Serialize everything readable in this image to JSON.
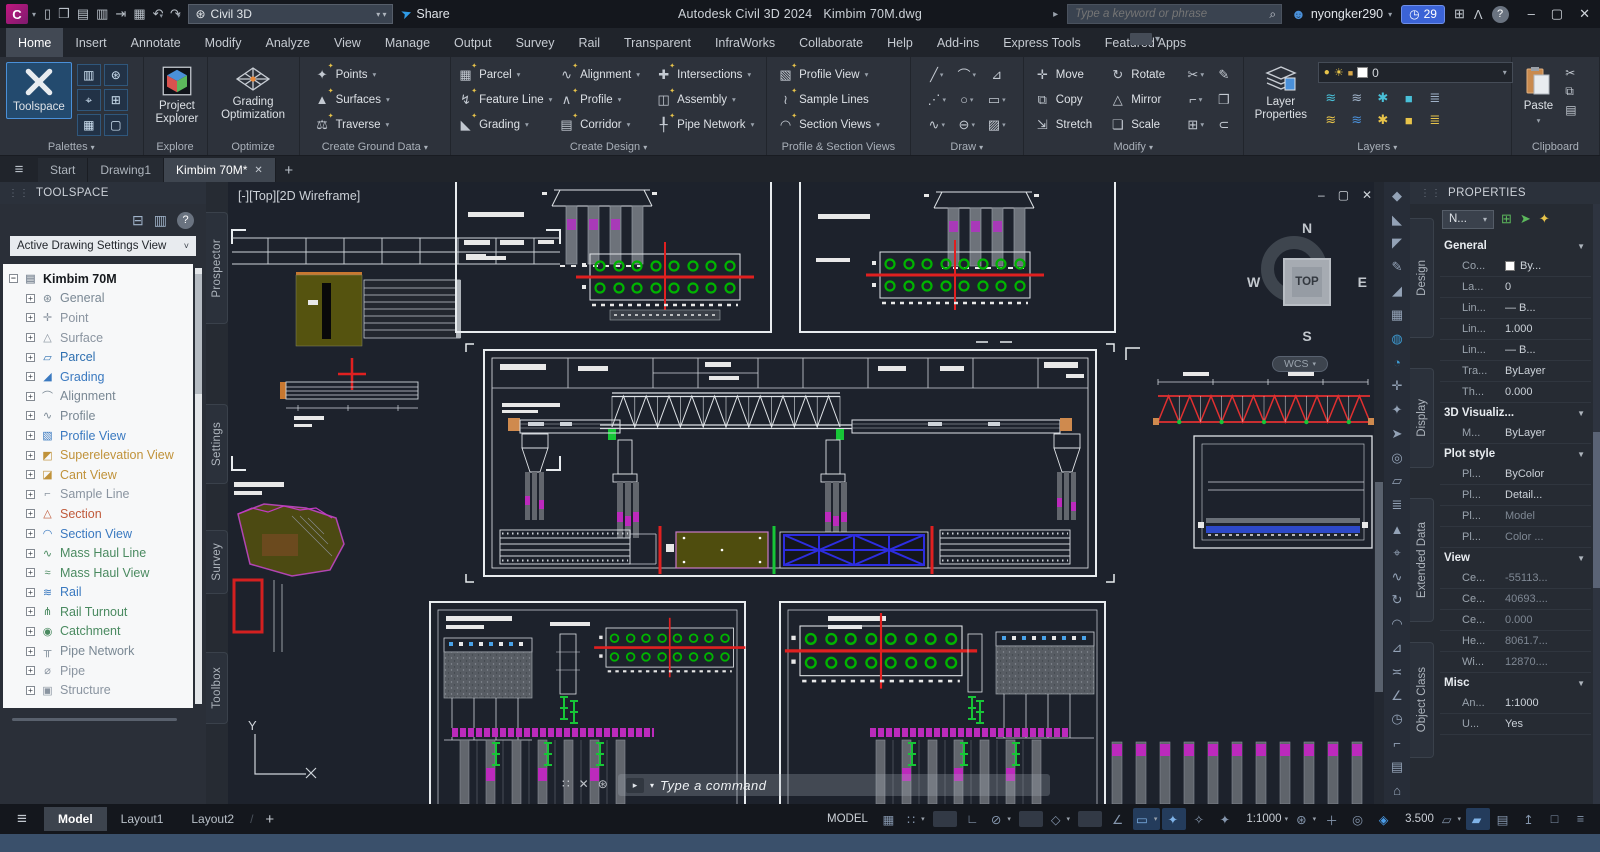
{
  "colors": {
    "canvas_bg": "#1d222c",
    "sheet_line": "#e8ecef",
    "pile_green": "#00b400",
    "magenta": "#bc2abc",
    "red": "#e02020",
    "olive": "#55530f",
    "brace_blue": "#2d2de0",
    "orange": "#c87830",
    "accent_blue": "#4a90d9",
    "trial_badge": "#3b63d6"
  },
  "titlebar": {
    "logo_letter": "C",
    "qat": [
      {
        "id": "new",
        "glyph": "▯"
      },
      {
        "id": "open",
        "glyph": "❒"
      },
      {
        "id": "save",
        "glyph": "▤"
      },
      {
        "id": "save-as",
        "glyph": "▥"
      },
      {
        "id": "export",
        "glyph": "⇥"
      },
      {
        "id": "plot",
        "glyph": "▦"
      },
      {
        "id": "undo",
        "glyph": "↶",
        "dd": true
      },
      {
        "id": "redo",
        "glyph": "↷",
        "dd": true
      }
    ],
    "workspace": {
      "label": "Civil 3D",
      "icon": "⊛"
    },
    "share": "Share",
    "app_title": "Autodesk Civil 3D 2024",
    "doc_title": "Kimbim 70M.dwg",
    "expand_arrow": "▸",
    "search_placeholder": "Type a keyword or phrase",
    "search_icon": "⌕",
    "user": "nyongker290",
    "trial": {
      "icon": "◷",
      "days": "29"
    },
    "cart_icon": "⊞",
    "autodesk_icon": "Λ",
    "help_icon": "?",
    "win": {
      "min": "–",
      "restore": "▢",
      "close": "✕"
    }
  },
  "ribbon": {
    "tabs": [
      {
        "label": "Home",
        "active": true
      },
      {
        "label": "Insert"
      },
      {
        "label": "Annotate"
      },
      {
        "label": "Modify"
      },
      {
        "label": "Analyze"
      },
      {
        "label": "View"
      },
      {
        "label": "Manage"
      },
      {
        "label": "Output"
      },
      {
        "label": "Survey"
      },
      {
        "label": "Rail"
      },
      {
        "label": "Transparent"
      },
      {
        "label": "InfraWorks"
      },
      {
        "label": "Collaborate"
      },
      {
        "label": "Help"
      },
      {
        "label": "Add-ins"
      },
      {
        "label": "Express Tools"
      },
      {
        "label": "Featured Apps"
      }
    ],
    "palettes": {
      "button": "Toolspace",
      "title": "Palettes",
      "caret": "▾",
      "small_icons": [
        {
          "id": "properties-palette",
          "glyph": "▥"
        },
        {
          "id": "settings-palette",
          "glyph": "⊛"
        },
        {
          "id": "survey-palette",
          "glyph": "⌖"
        },
        {
          "id": "toolbox-palette",
          "glyph": "⊞"
        },
        {
          "id": "sheet-set-manager",
          "glyph": "▦"
        },
        {
          "id": "command-line-palette",
          "glyph": "▢"
        }
      ]
    },
    "explore": {
      "button": "Project Explorer",
      "title": "Explore"
    },
    "optimize": {
      "button": "Grading Optimization",
      "title": "Optimize"
    },
    "ground": {
      "title": "Create Ground Data",
      "caret": "▾",
      "items": [
        {
          "id": "points",
          "label": "Points",
          "glyph": "✦",
          "dd": true
        },
        {
          "id": "surfaces",
          "label": "Surfaces",
          "glyph": "▲",
          "dd": true
        },
        {
          "id": "traverse",
          "label": "Traverse",
          "glyph": "⚖",
          "dd": true
        }
      ]
    },
    "design": {
      "title": "Create Design",
      "caret": "▾",
      "col1": [
        {
          "id": "parcel",
          "label": "Parcel",
          "glyph": "▦",
          "dd": true
        },
        {
          "id": "feature-line",
          "label": "Feature Line",
          "glyph": "↯",
          "dd": true
        },
        {
          "id": "grading",
          "label": "Grading",
          "glyph": "◣",
          "dd": true
        }
      ],
      "col2": [
        {
          "id": "alignment",
          "label": "Alignment",
          "glyph": "∿",
          "dd": true
        },
        {
          "id": "profile",
          "label": "Profile",
          "glyph": "∧",
          "dd": true
        },
        {
          "id": "corridor",
          "label": "Corridor",
          "glyph": "▤",
          "dd": true
        }
      ],
      "col3": [
        {
          "id": "intersections",
          "label": "Intersections",
          "glyph": "✚",
          "dd": true
        },
        {
          "id": "assembly",
          "label": "Assembly",
          "glyph": "◫",
          "dd": true
        },
        {
          "id": "pipe-network",
          "label": "Pipe Network",
          "glyph": "╀",
          "dd": true
        }
      ]
    },
    "psv": {
      "title": "Profile & Section Views",
      "items": [
        {
          "id": "profile-view",
          "label": "Profile View",
          "glyph": "▧",
          "dd": true
        },
        {
          "id": "sample-lines",
          "label": "Sample Lines",
          "glyph": "≀"
        },
        {
          "id": "section-views",
          "label": "Section Views",
          "glyph": "◠",
          "dd": true
        }
      ]
    },
    "draw": {
      "title": "Draw",
      "caret": "▾",
      "grid": [
        {
          "id": "line",
          "glyph": "╱",
          "dd": true
        },
        {
          "id": "arc",
          "glyph": "⌒",
          "dd": true
        },
        {
          "id": "polyline",
          "glyph": "⊿"
        },
        {
          "id": "construction-line",
          "glyph": "⋰",
          "dd": true
        },
        {
          "id": "circle",
          "glyph": "○",
          "dd": true
        },
        {
          "id": "rectangle",
          "glyph": "▭",
          "dd": true
        },
        {
          "id": "spline",
          "glyph": "∿",
          "dd": true
        },
        {
          "id": "ellipse",
          "glyph": "⊖",
          "dd": true
        },
        {
          "id": "hatch",
          "glyph": "▨",
          "dd": true
        }
      ]
    },
    "modify": {
      "title": "Modify",
      "caret": "▾",
      "col1": [
        {
          "id": "move",
          "label": "Move",
          "glyph": "✛"
        },
        {
          "id": "copy",
          "label": "Copy",
          "glyph": "⧉"
        },
        {
          "id": "stretch",
          "label": "Stretch",
          "glyph": "⇲"
        }
      ],
      "col2": [
        {
          "id": "rotate",
          "label": "Rotate",
          "glyph": "↻"
        },
        {
          "id": "mirror",
          "label": "Mirror",
          "glyph": "△"
        },
        {
          "id": "scale",
          "label": "Scale",
          "glyph": "❏"
        }
      ],
      "icons1": [
        {
          "id": "trim",
          "glyph": "✂",
          "dd": true
        },
        {
          "id": "fillet",
          "glyph": "⌐",
          "dd": true
        },
        {
          "id": "array",
          "glyph": "⊞",
          "dd": true
        }
      ],
      "icons2": [
        {
          "id": "erase",
          "glyph": "✎"
        },
        {
          "id": "explode",
          "glyph": "❐"
        },
        {
          "id": "overkill",
          "glyph": "⊂"
        }
      ]
    },
    "layers": {
      "button": "Layer Properties",
      "title": "Layers",
      "caret": "▾",
      "current_layer": "0",
      "combo_icons": [
        {
          "id": "layer-on",
          "glyph": "●",
          "color": "#e8c44a"
        },
        {
          "id": "layer-sun",
          "glyph": "☀",
          "color": "#e8c44a"
        },
        {
          "id": "layer-lock",
          "glyph": "■",
          "color": "#d9a84a"
        }
      ],
      "tools": [
        {
          "id": "layer-isolate",
          "glyph": "≋",
          "color": "#49c0d8"
        },
        {
          "id": "layer-unisolate",
          "glyph": "≋",
          "color": "#9fb2c8"
        },
        {
          "id": "layer-freeze",
          "glyph": "✱",
          "color": "#49c0d8"
        },
        {
          "id": "layer-lock-tool",
          "glyph": "■",
          "color": "#49c0d8"
        },
        {
          "id": "layer-states",
          "glyph": "≣",
          "color": "#9fb2c8"
        },
        {
          "id": "layer-off",
          "glyph": "≋",
          "color": "#e8c44a"
        },
        {
          "id": "layer-match",
          "glyph": "≋",
          "color": "#4a90d9"
        },
        {
          "id": "layer-cur",
          "glyph": "✱",
          "color": "#e8c44a"
        },
        {
          "id": "layer-unlock",
          "glyph": "■",
          "color": "#e8c44a"
        },
        {
          "id": "layer-walk",
          "glyph": "≣",
          "color": "#e8c44a"
        }
      ]
    },
    "clipboard": {
      "button": "Paste",
      "title": "Clipboard",
      "caret": "▾",
      "small": [
        {
          "id": "cut",
          "glyph": "✂"
        },
        {
          "id": "copy-clip",
          "glyph": "⧉"
        },
        {
          "id": "match-properties",
          "glyph": "▤"
        }
      ]
    }
  },
  "file_tabs": {
    "menu_icon": "≡",
    "tabs": [
      {
        "label": "Start"
      },
      {
        "label": "Drawing1"
      },
      {
        "label": "Kimbim 70M*",
        "active": true,
        "closable": true
      }
    ],
    "new_tab": "+"
  },
  "toolspace": {
    "title": "TOOLSPACE",
    "grip": "⋮⋮",
    "toolbar": [
      {
        "id": "item-view",
        "glyph": "⊟"
      },
      {
        "id": "panorama",
        "glyph": "▥"
      },
      {
        "id": "help",
        "glyph": "?"
      }
    ],
    "view_selector": "Active Drawing Settings View",
    "root": {
      "label": "Kimbim 70M",
      "glyph": "▤"
    },
    "tree": [
      {
        "id": "general",
        "label": "General",
        "glyph": "⊛",
        "color": "#7a8894"
      },
      {
        "id": "point",
        "label": "Point",
        "glyph": "✛",
        "color": "#8a94a0"
      },
      {
        "id": "surface",
        "label": "Surface",
        "glyph": "△",
        "color": "#8a94a0"
      },
      {
        "id": "parcel",
        "label": "Parcel",
        "glyph": "▱",
        "color": "#2e6fb0"
      },
      {
        "id": "grading",
        "label": "Grading",
        "glyph": "◢",
        "color": "#3a79c0"
      },
      {
        "id": "alignment",
        "label": "Alignment",
        "glyph": "⌒",
        "color": "#7a8894"
      },
      {
        "id": "profile",
        "label": "Profile",
        "glyph": "∿",
        "color": "#7a8894"
      },
      {
        "id": "profile-view",
        "label": "Profile View",
        "glyph": "▧",
        "color": "#3a79c0"
      },
      {
        "id": "superelevation-view",
        "label": "Superelevation View",
        "glyph": "◩",
        "color": "#c0923a"
      },
      {
        "id": "cant-view",
        "label": "Cant View",
        "glyph": "◪",
        "color": "#c0923a"
      },
      {
        "id": "sample-line",
        "label": "Sample Line",
        "glyph": "⌐",
        "color": "#8a94a0"
      },
      {
        "id": "section",
        "label": "Section",
        "glyph": "△",
        "color": "#c05a3a"
      },
      {
        "id": "section-view",
        "label": "Section View",
        "glyph": "◠",
        "color": "#3a79c0"
      },
      {
        "id": "mass-haul-line",
        "label": "Mass Haul Line",
        "glyph": "∿",
        "color": "#4a8a60"
      },
      {
        "id": "mass-haul-view",
        "label": "Mass Haul View",
        "glyph": "≈",
        "color": "#4a8a60"
      },
      {
        "id": "rail",
        "label": "Rail",
        "glyph": "≋",
        "color": "#3a79c0"
      },
      {
        "id": "rail-turnout",
        "label": "Rail Turnout",
        "glyph": "⋔",
        "color": "#4a8a60"
      },
      {
        "id": "catchment",
        "label": "Catchment",
        "glyph": "◉",
        "color": "#4a8a60"
      },
      {
        "id": "pipe-network",
        "label": "Pipe Network",
        "glyph": "╥",
        "color": "#7a8894"
      },
      {
        "id": "pipe",
        "label": "Pipe",
        "glyph": "⌀",
        "color": "#8a94a0"
      },
      {
        "id": "structure",
        "label": "Structure",
        "glyph": "▣",
        "color": "#8a94a0"
      }
    ],
    "side_tabs": [
      {
        "label": "Prospector"
      },
      {
        "label": "Settings"
      },
      {
        "label": "Survey"
      },
      {
        "label": "Toolbox"
      }
    ]
  },
  "canvas": {
    "viewport_label": "[-][Top][2D Wireframe]",
    "win": {
      "min": "–",
      "restore": "▢",
      "close": "✕"
    },
    "viewcube": {
      "n": "N",
      "w": "W",
      "e": "E",
      "s": "S",
      "top": "TOP",
      "wcs": "WCS",
      "wcs_caret": "▾"
    },
    "command": {
      "grip": "∷",
      "close": "✕",
      "customize": "⊛",
      "prompt_icon": "▸",
      "caret": "▾",
      "placeholder": "Type a command"
    }
  },
  "right_toolbar": {
    "icons": [
      {
        "id": "sheet-views",
        "glyph": "◆"
      },
      {
        "id": "model-views",
        "glyph": "◣"
      },
      {
        "id": "named-views",
        "glyph": "◤"
      },
      {
        "id": "annotate-tool",
        "glyph": "✎"
      },
      {
        "id": "slope-tool",
        "glyph": "◢"
      },
      {
        "id": "grid-tool",
        "glyph": "▦"
      },
      {
        "id": "geolocation",
        "glyph": "◍",
        "color": "#3d9ad1"
      },
      {
        "id": "online-map",
        "glyph": "◔",
        "color": "#3d9ad1"
      },
      {
        "id": "point-create",
        "glyph": "✛"
      },
      {
        "id": "point-label",
        "glyph": "✦"
      },
      {
        "id": "point-select",
        "glyph": "➤"
      },
      {
        "id": "point-group",
        "glyph": "◎"
      },
      {
        "id": "surface-tool",
        "glyph": "▱"
      },
      {
        "id": "layers-tool",
        "glyph": "≣"
      },
      {
        "id": "marker-tool",
        "glyph": "▲"
      },
      {
        "id": "target-tool",
        "glyph": "⌖"
      },
      {
        "id": "curve-tool",
        "glyph": "∿"
      },
      {
        "id": "rotate-view",
        "glyph": "↻"
      },
      {
        "id": "arc-tool",
        "glyph": "◠"
      },
      {
        "id": "section-tool",
        "glyph": "⊿"
      },
      {
        "id": "join-tool",
        "glyph": "≍"
      },
      {
        "id": "angle-tool",
        "glyph": "∠"
      },
      {
        "id": "time-tool",
        "glyph": "◷"
      },
      {
        "id": "measure-tool",
        "glyph": "⌐"
      },
      {
        "id": "sheet-tool",
        "glyph": "▤"
      },
      {
        "id": "home-tool",
        "glyph": "⌂"
      }
    ]
  },
  "properties": {
    "title": "PROPERTIES",
    "grip": "⋮⋮",
    "selector": "N...",
    "selector_caret": "▾",
    "header_icons": [
      {
        "id": "toggle-pickadd",
        "glyph": "⊞",
        "color": "#5cb85c"
      },
      {
        "id": "select-objects",
        "glyph": "➤",
        "color": "#5cb85c"
      },
      {
        "id": "quick-select",
        "glyph": "✦",
        "color": "#e8c44a"
      }
    ],
    "side_tabs": [
      {
        "label": "Design"
      },
      {
        "label": "Display"
      },
      {
        "label": "Extended Data"
      },
      {
        "label": "Object Class"
      }
    ],
    "rows": [
      {
        "type": "header",
        "label": "General"
      },
      {
        "label": "Co...",
        "value": "By...",
        "swatch": "#ffffff"
      },
      {
        "label": "La...",
        "value": "0"
      },
      {
        "label": "Lin...",
        "value": "— B..."
      },
      {
        "label": "Lin...",
        "value": "1.000"
      },
      {
        "label": "Lin...",
        "value": "— B..."
      },
      {
        "label": "Tra...",
        "value": "ByLayer"
      },
      {
        "label": "Th...",
        "value": "0.000"
      },
      {
        "type": "header",
        "label": "3D Visualiz..."
      },
      {
        "label": "M...",
        "value": "ByLayer"
      },
      {
        "type": "header",
        "label": "Plot style"
      },
      {
        "label": "Pl...",
        "value": "ByColor"
      },
      {
        "label": "Pl...",
        "value": "Detail..."
      },
      {
        "label": "Pl...",
        "value": "Model",
        "dim": true
      },
      {
        "label": "Pl...",
        "value": "Color ...",
        "dim": true
      },
      {
        "type": "header",
        "label": "View"
      },
      {
        "label": "Ce...",
        "value": "-55113...",
        "dim": true
      },
      {
        "label": "Ce...",
        "value": "40693....",
        "dim": true
      },
      {
        "label": "Ce...",
        "value": "0.000",
        "dim": true
      },
      {
        "label": "He...",
        "value": "8061.7...",
        "dim": true
      },
      {
        "label": "Wi...",
        "value": "12870....",
        "dim": true
      },
      {
        "type": "header",
        "label": "Misc"
      },
      {
        "label": "An...",
        "value": "1:1000"
      },
      {
        "label": "U...",
        "value": "Yes"
      }
    ]
  },
  "statusbar": {
    "menu_icon": "≡",
    "layout_tabs": [
      {
        "label": "Model",
        "active": true
      },
      {
        "label": "Layout1"
      },
      {
        "label": "Layout2"
      }
    ],
    "tab_sep": "/",
    "new_layout": "+",
    "model_label": "MODEL",
    "buttons": [
      {
        "id": "grid",
        "glyph": "▦"
      },
      {
        "id": "snap",
        "glyph": "∷",
        "dd": true
      },
      {
        "type": "sep"
      },
      {
        "id": "ortho",
        "glyph": "∟"
      },
      {
        "id": "polar",
        "glyph": "⊘",
        "dd": true
      },
      {
        "type": "sep"
      },
      {
        "id": "isodraft",
        "glyph": "◇",
        "dd": true
      },
      {
        "type": "sep"
      },
      {
        "id": "otrack",
        "glyph": "∠"
      },
      {
        "id": "osnap",
        "glyph": "▭",
        "dd": true,
        "active": true
      },
      {
        "id": "annotation-visibility",
        "glyph": "✦",
        "active": true
      },
      {
        "id": "autoscale",
        "glyph": "✧"
      },
      {
        "id": "annotation-scale-icon",
        "glyph": "✦"
      },
      {
        "id": "annotation-scale",
        "label": "1:1000",
        "dd": true
      },
      {
        "id": "workspace-switching",
        "glyph": "⊛",
        "dd": true
      },
      {
        "id": "annotation-monitor",
        "glyph": "＋"
      },
      {
        "id": "isolate-objects",
        "glyph": "◎"
      },
      {
        "id": "hardware-acceleration",
        "glyph": "◈",
        "color": "#4a9ce8"
      },
      {
        "id": "lineweight",
        "label": "3.500"
      },
      {
        "id": "clean-screen-tag",
        "glyph": "▱",
        "dd": true
      },
      {
        "id": "annotation-tag",
        "glyph": "▰",
        "active": true
      },
      {
        "id": "plot-status",
        "glyph": "▤"
      },
      {
        "id": "tray",
        "glyph": "↥"
      },
      {
        "id": "fullscreen",
        "glyph": "□"
      },
      {
        "id": "customization",
        "glyph": "≡"
      }
    ]
  }
}
